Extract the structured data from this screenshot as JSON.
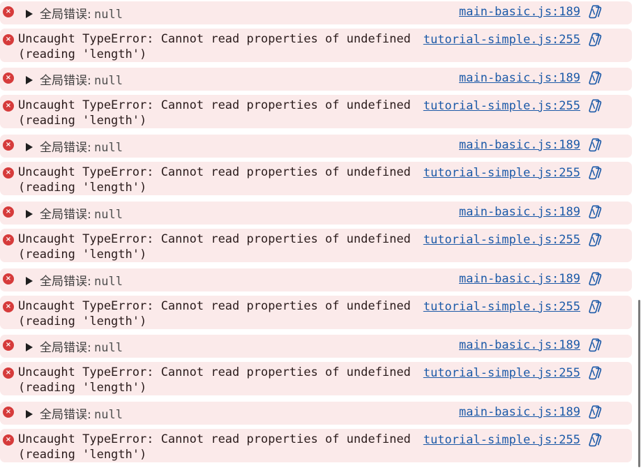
{
  "console": {
    "entries": [
      {
        "type": "global",
        "label": "全局错误:",
        "value": "null",
        "source": "main-basic.js:189"
      },
      {
        "type": "typeerror",
        "line1": "Uncaught TypeError: Cannot read properties of undefined",
        "line2": "(reading 'length')",
        "source": "tutorial-simple.js:255"
      },
      {
        "type": "global",
        "label": "全局错误:",
        "value": "null",
        "source": "main-basic.js:189"
      },
      {
        "type": "typeerror",
        "line1": "Uncaught TypeError: Cannot read properties of undefined",
        "line2": "(reading 'length')",
        "source": "tutorial-simple.js:255"
      },
      {
        "type": "global",
        "label": "全局错误:",
        "value": "null",
        "source": "main-basic.js:189"
      },
      {
        "type": "typeerror",
        "line1": "Uncaught TypeError: Cannot read properties of undefined",
        "line2": "(reading 'length')",
        "source": "tutorial-simple.js:255"
      },
      {
        "type": "global",
        "label": "全局错误:",
        "value": "null",
        "source": "main-basic.js:189"
      },
      {
        "type": "typeerror",
        "line1": "Uncaught TypeError: Cannot read properties of undefined",
        "line2": "(reading 'length')",
        "source": "tutorial-simple.js:255"
      },
      {
        "type": "global",
        "label": "全局错误:",
        "value": "null",
        "source": "main-basic.js:189"
      },
      {
        "type": "typeerror",
        "line1": "Uncaught TypeError: Cannot read properties of undefined",
        "line2": "(reading 'length')",
        "source": "tutorial-simple.js:255"
      },
      {
        "type": "global",
        "label": "全局错误:",
        "value": "null",
        "source": "main-basic.js:189"
      },
      {
        "type": "typeerror",
        "line1": "Uncaught TypeError: Cannot read properties of undefined",
        "line2": "(reading 'length')",
        "source": "tutorial-simple.js:255"
      },
      {
        "type": "global",
        "label": "全局错误:",
        "value": "null",
        "source": "main-basic.js:189"
      },
      {
        "type": "typeerror",
        "line1": "Uncaught TypeError: Cannot read properties of undefined",
        "line2": "(reading 'length')",
        "source": "tutorial-simple.js:255"
      }
    ]
  },
  "icons": {
    "error": "error-circle-icon",
    "expand": "expand-triangle-icon",
    "copilot": "copilot-explain-icon"
  },
  "colors": {
    "entry_background": "#fbeaea",
    "error_icon": "#d63b3b",
    "link": "#1c5aa8"
  }
}
